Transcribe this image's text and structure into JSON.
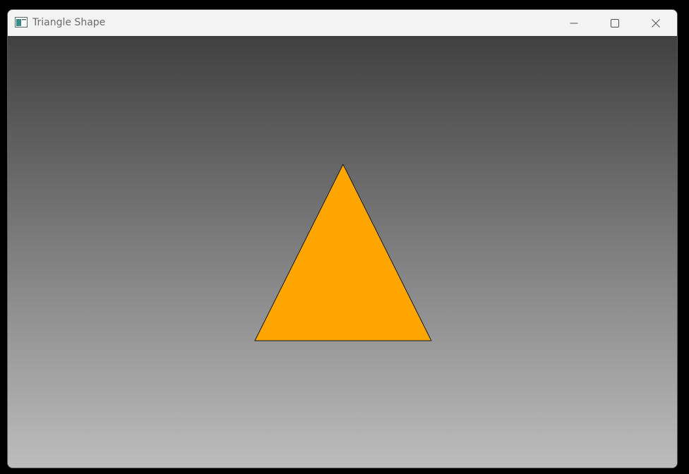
{
  "window": {
    "title": "Triangle Shape",
    "title_color": "#6b6b6b",
    "app_icon": "window-app-icon"
  },
  "caption_buttons": {
    "minimize_icon": "minimize-icon",
    "maximize_icon": "maximize-icon",
    "close_icon": "close-icon"
  },
  "canvas": {
    "background_gradient": [
      "#404040",
      "#bdbdbd"
    ]
  },
  "shape": {
    "type": "triangle",
    "fill": "#ffa500",
    "stroke": "#1a1a1a"
  }
}
